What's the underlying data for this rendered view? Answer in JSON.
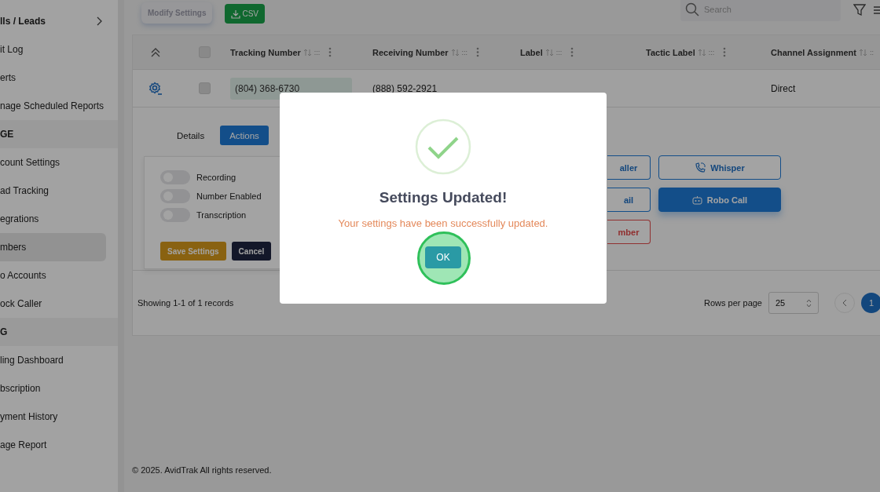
{
  "sidebar": {
    "items": [
      {
        "kind": "item",
        "label": "lls / Leads",
        "bold": true,
        "chevron": true,
        "selected": false
      },
      {
        "kind": "item",
        "label": "it Log",
        "selected": false
      },
      {
        "kind": "item",
        "label": "erts",
        "selected": false
      },
      {
        "kind": "item",
        "label": "nage Scheduled Reports",
        "selected": false
      },
      {
        "kind": "section",
        "label": "GE"
      },
      {
        "kind": "item",
        "label": "count Settings",
        "selected": false
      },
      {
        "kind": "item",
        "label": "ad Tracking",
        "selected": false
      },
      {
        "kind": "item",
        "label": "egrations",
        "selected": false
      },
      {
        "kind": "item",
        "label": "mbers",
        "selected": true
      },
      {
        "kind": "item",
        "label": "o Accounts",
        "selected": false
      },
      {
        "kind": "item",
        "label": "ock Caller",
        "selected": false
      },
      {
        "kind": "section",
        "label": "G"
      },
      {
        "kind": "item",
        "label": "ling Dashboard",
        "selected": false
      },
      {
        "kind": "item",
        "label": "bscription",
        "selected": false
      },
      {
        "kind": "item",
        "label": "yment History",
        "selected": false
      },
      {
        "kind": "item",
        "label": "age Report",
        "selected": false
      }
    ]
  },
  "toolbar": {
    "modify_button": {
      "label": "Modify Settings",
      "disabled": true
    },
    "csv_button": {
      "label": "CSV"
    },
    "search": {
      "placeholder": "Search"
    }
  },
  "table": {
    "columns": [
      {
        "label": "Tracking Number",
        "drag": ":::"
      },
      {
        "label": "Receiving Number",
        "drag": ":::"
      },
      {
        "label": "Label",
        "drag": ":::"
      },
      {
        "label": "Tactic Label",
        "drag": ":::"
      },
      {
        "label": "Channel Assignment",
        "drag": "::"
      }
    ],
    "header_checked": false,
    "rows": [
      {
        "checked": false,
        "cells": [
          "(804) 368-6730",
          "(888) 592-2921",
          "",
          "",
          "Direct"
        ]
      }
    ]
  },
  "details": {
    "tabs": [
      {
        "label": "Details",
        "selected": false
      },
      {
        "label": "Actions",
        "selected": true
      }
    ],
    "toggles": [
      {
        "label": "Recording",
        "on": false
      },
      {
        "label": "Number Enabled",
        "on": false
      },
      {
        "label": "Transcription",
        "on": false
      }
    ],
    "save_button": "Save Settings",
    "cancel_button": "Cancel",
    "actions": [
      {
        "label": "aller",
        "kind": "outline"
      },
      {
        "label": "Whisper",
        "kind": "outline"
      },
      {
        "label": "ail",
        "kind": "outline"
      },
      {
        "label": "Robo Call",
        "kind": "filled"
      },
      {
        "label": "mber",
        "kind": "danger"
      }
    ]
  },
  "footer": {
    "records": "Showing 1-1 of 1 records",
    "rows_per_page_label": "Rows per page",
    "rows_per_page": "25",
    "pages": [
      {
        "label": "1",
        "selected": true
      }
    ]
  },
  "copyright": "© 2025. AvidTrak All rights reserved.",
  "modal": {
    "title": "Settings Updated!",
    "message": "Your settings have been successfully updated.",
    "ok_button": "OK",
    "highlighted": true
  }
}
